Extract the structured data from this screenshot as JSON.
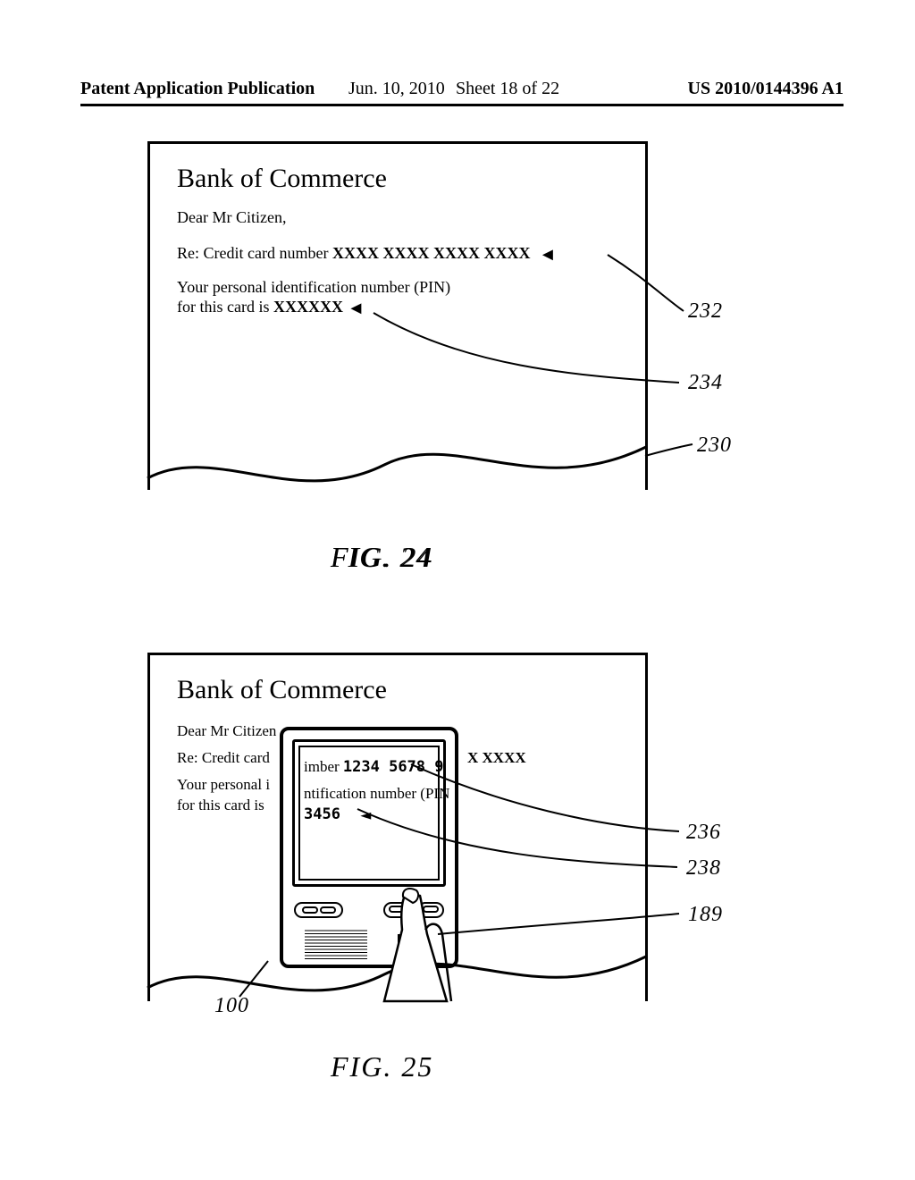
{
  "header": {
    "pub": "Patent Application Publication",
    "date": "Jun. 10, 2010",
    "sheet": "Sheet 18 of 22",
    "appno": "US 2010/0144396 A1"
  },
  "fig24": {
    "caption": "FIG. 24",
    "title": "Bank of Commerce",
    "greeting": "Dear Mr Citizen,",
    "cc_prefix": "Re: Credit card number ",
    "cc_masked": "XXXX  XXXX  XXXX  XXXX",
    "pin_line1": "Your personal identification number (PIN)",
    "pin_line2_prefix": "for this card is ",
    "pin_masked": "XXXXXX",
    "ref_letter": "230",
    "ref_ccnum": "232",
    "ref_pin": "234"
  },
  "fig25": {
    "caption": "FIG. 25",
    "title": "Bank of Commerce",
    "greeting_left": "Dear Mr Citizen",
    "cc_left": "Re: Credit card",
    "pin1_left": "Your personal i",
    "pin2_left": "for this card is ",
    "screen_r2a": "imber ",
    "screen_r2b": "1234  5678  9",
    "screen_r3": "ntification number (PIN",
    "screen_r4": "3456",
    "right_of_device": "X  XXXX",
    "ref_device": "100",
    "ref_finger": "189",
    "ref_ccnum": "236",
    "ref_pin": "238"
  }
}
